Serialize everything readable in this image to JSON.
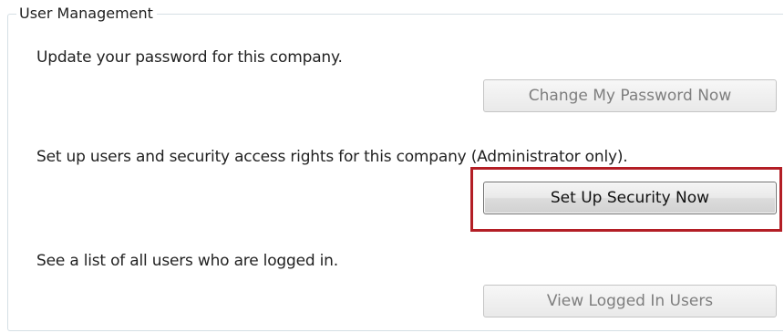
{
  "group": {
    "title": "User Management"
  },
  "password": {
    "description": "Update your password for this company.",
    "button_label": "Change My Password Now",
    "button_state": "disabled"
  },
  "security": {
    "description": "Set up users and security access rights for this company (Administrator only).",
    "button_label": "Set Up Security Now",
    "button_state": "enabled",
    "highlight_color": "#b31e25"
  },
  "logged_in": {
    "description": "See a list of all users who are logged in.",
    "button_label": "View Logged In Users",
    "button_state": "disabled"
  }
}
